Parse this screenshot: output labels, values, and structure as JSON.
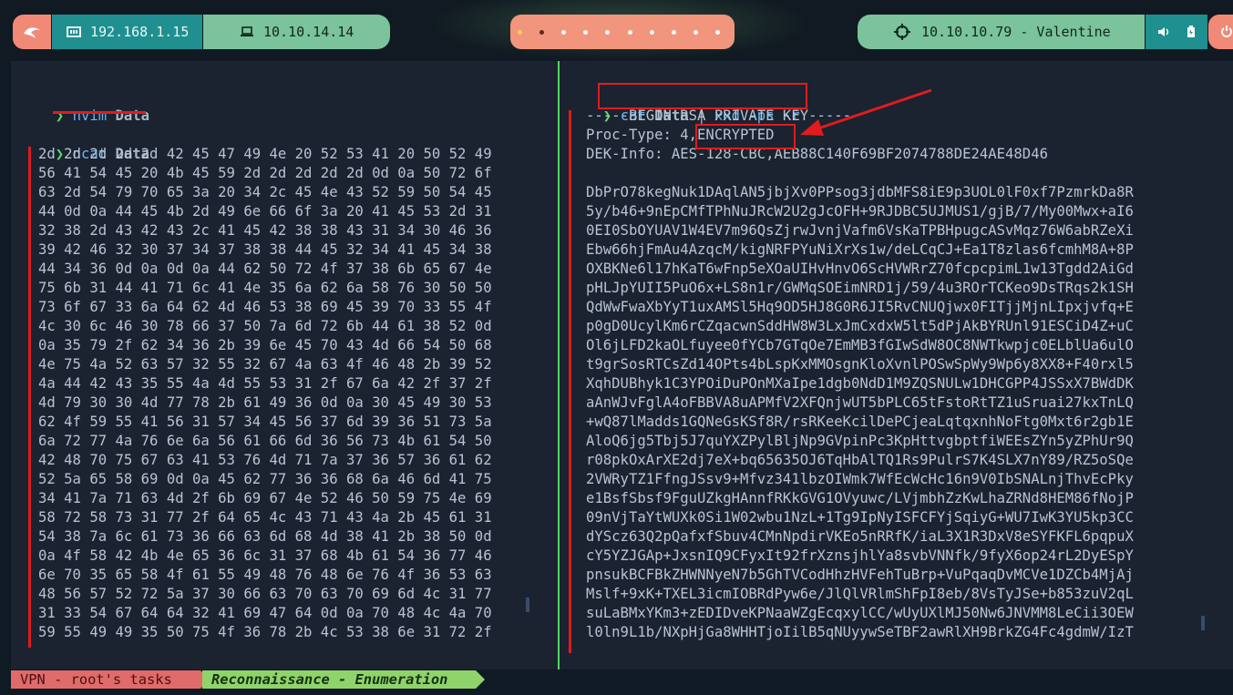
{
  "topbar": {
    "local_ip": "192.168.1.15",
    "vpn_ip": "10.10.14.14",
    "target": "10.10.10.79 - Valentine",
    "icons": [
      "kali-dragon-icon",
      "network-card-icon",
      "laptop-icon",
      "crosshair-icon",
      "volume-icon",
      "battery-icon",
      "power-icon"
    ],
    "workspaces_count": 10,
    "colors": {
      "coral": "#f08a77",
      "teal": "#1f8f8f",
      "green": "#7bc39b"
    }
  },
  "left_pane": {
    "cmd1": {
      "program": "nvim",
      "arg": "Data"
    },
    "cmd2": {
      "program": "ncat",
      "arg": "Data"
    },
    "hex_lines": [
      "2d 2d 2d 2d 2d 42 45 47 49 4e 20 52 53 41 20 50 52 49",
      "56 41 54 45 20 4b 45 59 2d 2d 2d 2d 2d 0d 0a 50 72 6f",
      "63 2d 54 79 70 65 3a 20 34 2c 45 4e 43 52 59 50 54 45",
      "44 0d 0a 44 45 4b 2d 49 6e 66 6f 3a 20 41 45 53 2d 31",
      "32 38 2d 43 42 43 2c 41 45 42 38 38 43 31 34 30 46 36",
      "39 42 46 32 30 37 34 37 38 38 44 45 32 34 41 45 34 38",
      "44 34 36 0d 0a 0d 0a 44 62 50 72 4f 37 38 6b 65 67 4e",
      "75 6b 31 44 41 71 6c 41 4e 35 6a 62 6a 58 76 30 50 50",
      "73 6f 67 33 6a 64 62 4d 46 53 38 69 45 39 70 33 55 4f",
      "4c 30 6c 46 30 78 66 37 50 7a 6d 72 6b 44 61 38 52 0d",
      "0a 35 79 2f 62 34 36 2b 39 6e 45 70 43 4d 66 54 50 68",
      "4e 75 4a 52 63 57 32 55 32 67 4a 63 4f 46 48 2b 39 52",
      "4a 44 42 43 35 55 4a 4d 55 53 31 2f 67 6a 42 2f 37 2f",
      "4d 79 30 30 4d 77 78 2b 61 49 36 0d 0a 30 45 49 30 53",
      "62 4f 59 55 41 56 31 57 34 45 56 37 6d 39 36 51 73 5a",
      "6a 72 77 4a 76 6e 6a 56 61 66 6d 36 56 73 4b 61 54 50",
      "42 48 70 75 67 63 41 53 76 4d 71 7a 37 36 57 36 61 62",
      "52 5a 65 58 69 0d 0a 45 62 77 36 36 68 6a 46 6d 41 75",
      "34 41 7a 71 63 4d 2f 6b 69 67 4e 52 46 50 59 75 4e 69",
      "58 72 58 73 31 77 2f 64 65 4c 43 71 43 4a 2b 45 61 31",
      "54 38 7a 6c 61 73 36 66 63 6d 68 4d 38 41 2b 38 50 0d",
      "0a 4f 58 42 4b 4e 65 36 6c 31 37 68 4b 61 54 36 77 46",
      "6e 70 35 65 58 4f 61 55 49 48 76 48 6e 76 4f 36 53 63",
      "48 56 57 52 72 5a 37 30 66 63 70 63 70 69 6d 4c 31 77",
      "31 33 54 67 64 64 32 41 69 47 64 0d 0a 70 48 4c 4a 70",
      "59 55 49 49 35 50 75 4f 36 78 2b 4c 53 38 6e 31 72 2f"
    ]
  },
  "right_pane": {
    "cmd": {
      "program": "cat",
      "arg": "Data",
      "pipe": "|",
      "program2": "xxd",
      "flags": "-ps -r"
    },
    "key_lines": [
      "-----BEGIN RSA PRIVATE KEY-----",
      "Proc-Type: 4,ENCRYPTED",
      "DEK-Info: AES-128-CBC,AEB88C140F69BF2074788DE24AE48D46",
      "",
      "DbPrO78kegNuk1DAqlAN5jbjXv0PPsog3jdbMFS8iE9p3UOL0lF0xf7PzmrkDa8R",
      "5y/b46+9nEpCMfTPhNuJRcW2U2gJcOFH+9RJDBC5UJMUS1/gjB/7/My00Mwx+aI6",
      "0EI0SbOYUAV1W4EV7m96QsZjrwJvnjVafm6VsKaTPBHpugcASvMqz76W6abRZeXi",
      "Ebw66hjFmAu4AzqcM/kigNRFPYuNiXrXs1w/deLCqCJ+Ea1T8zlas6fcmhM8A+8P",
      "OXBKNe6l17hKaT6wFnp5eXOaUIHvHnvO6ScHVWRrZ70fcpcpimL1w13Tgdd2AiGd",
      "pHLJpYUII5PuO6x+LS8n1r/GWMqSOEimNRD1j/59/4u3ROrTCKeo9DsTRqs2k1SH",
      "QdWwFwaXbYyT1uxAMSl5Hq9OD5HJ8G0R6JI5RvCNUQjwx0FITjjMjnLIpxjvfq+E",
      "p0gD0UcylKm6rCZqacwnSddHW8W3LxJmCxdxW5lt5dPjAkBYRUnl91ESCiD4Z+uC",
      "Ol6jLFD2kaOLfuyee0fYCb7GTqOe7EmMB3fGIwSdW8OC8NWTkwpjc0ELblUa6ulO",
      "t9grSosRTCsZd14OPts4bLspKxMMOsgnKloXvnlPOSwSpWy9Wp6y8XX8+F40rxl5",
      "XqhDUBhyk1C3YPOiDuPOnMXaIpe1dgb0NdD1M9ZQSNULw1DHCGPP4JSSxX7BWdDK",
      "aAnWJvFglA4oFBBVA8uAPMfV2XFQnjwUT5bPLC65tFstoRtTZ1uSruai27kxTnLQ",
      "+wQ87lMadds1GQNeGsKSf8R/rsRKeeKcilDePCjeaLqtqxnhNoFtg0Mxt6r2gb1E",
      "AloQ6jg5Tbj5J7quYXZPylBljNp9GVpinPc3KpHttvgbptfiWEEsZYn5yZPhUr9Q",
      "r08pkOxArXE2dj7eX+bq65635OJ6TqHbAlTQ1Rs9PulrS7K4SLX7nY89/RZ5oSQe",
      "2VWRyTZ1FfngJSsv9+Mfvz341lbzOIWmk7WfEcWcHc16n9V0IbSNALnjThvEcPky",
      "e1BsfSbsf9FguUZkgHAnnfRKkGVG1OVyuwc/LVjmbhZzKwLhaZRNd8HEM86fNojP",
      "09nVjTaYtWUXk0Si1W02wbu1NzL+1Tg9IpNyISFCFYjSqiyG+WU7IwK3YU5kp3CC",
      "dYScz63Q2pQafxfSbuv4CMnNpdirVKEo5nRRfK/iaL3X1R3DxV8eSYFKFL6pqpuX",
      "cY5YZJGAp+JxsnIQ9CFyxIt92frXznsjhlYa8svbVNNfk/9fyX6op24rL2DyESpY",
      "pnsukBCFBkZHWNNyeN7b5GhTVCodHhzHVFehTuBrp+VuPqaqDvMCVe1DZCb4MjAj",
      "Mslf+9xK+TXEL3icmIOBRdPyw6e/JlQlVRlmShFpI8eb/8VsTyJSe+b853zuV2qL",
      "suLaBMxYKm3+zEDIDveKPNaaWZgEcqxylCC/wUyUXlMJ50Nw6JNVMM8LeCii3OEW",
      "l0ln9L1b/NXpHjGa8WHHTjoIilB5qNUyywSeTBF2awRlXH9BrkZG4Fc4gdmW/IzT"
    ]
  },
  "statusbar": {
    "tab1": "VPN - root's tasks",
    "tab2": "Reconnaissance - Enumeration"
  },
  "annotation_color": "#e01c1c"
}
